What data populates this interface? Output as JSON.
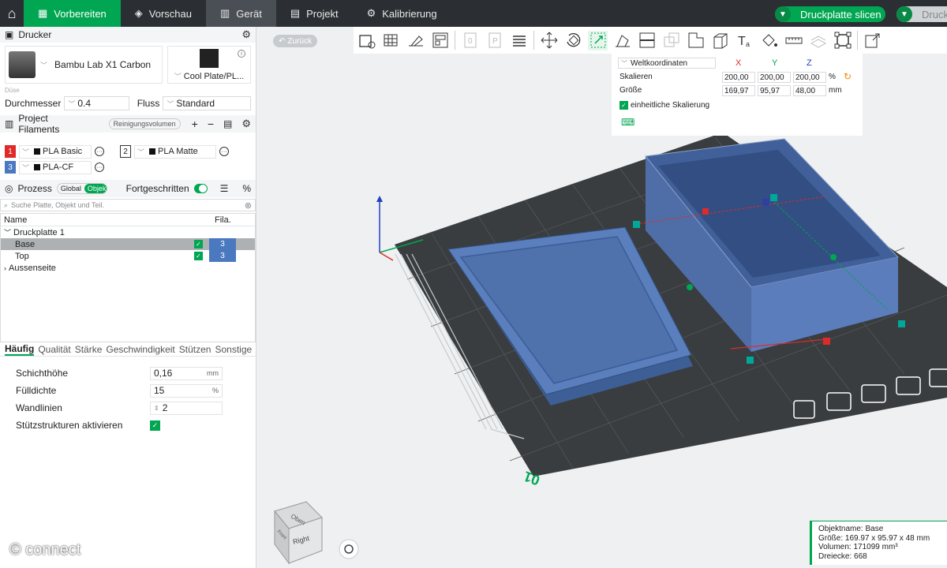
{
  "topbar": {
    "tabs": [
      {
        "label": "Vorbereiten"
      },
      {
        "label": "Vorschau"
      },
      {
        "label": "Gerät"
      },
      {
        "label": "Projekt"
      },
      {
        "label": "Kalibrierung"
      }
    ],
    "slice_label": "Druckplatte slicen",
    "print_label": "Druck"
  },
  "printer": {
    "section_title": "Drucker",
    "name": "Bambu Lab X1 Carbon",
    "plate": "Cool Plate/PL...",
    "nozzle_section": "Düse",
    "diameter_label": "Durchmesser",
    "diameter_value": "0.4",
    "flow_label": "Fluss",
    "flow_value": "Standard"
  },
  "filaments": {
    "section_title": "Project Filaments",
    "purge_label": "Reinigungsvolumen",
    "items": [
      {
        "num": "1",
        "name": "PLA Basic",
        "color": "#e02a2a"
      },
      {
        "num": "2",
        "name": "PLA Matte",
        "color": "#ffffff"
      },
      {
        "num": "3",
        "name": "PLA-CF",
        "color": "#4a79c0"
      }
    ]
  },
  "process": {
    "section_title": "Prozess",
    "mode_global": "Global",
    "mode_objects": "Objekte",
    "advanced_label": "Fortgeschritten",
    "search_placeholder": "Suche Platte, Objekt und Teil.",
    "col_name": "Name",
    "col_fila": "Fila.",
    "tree": [
      {
        "label": "Druckplatte 1"
      },
      {
        "label": "Base",
        "fila": "3"
      },
      {
        "label": "Top",
        "fila": "3"
      },
      {
        "label": "Aussenseite"
      }
    ],
    "tabs": [
      "Häufig",
      "Qualität",
      "Stärke",
      "Geschwindigkeit",
      "Stützen",
      "Sonstige"
    ],
    "params": [
      {
        "label": "Schichthöhe",
        "value": "0,16",
        "unit": "mm"
      },
      {
        "label": "Fülldichte",
        "value": "15",
        "unit": "%"
      },
      {
        "label": "Wandlinien",
        "value": "2",
        "unit": ""
      },
      {
        "label": "Stützstrukturen aktivieren",
        "checked": true
      }
    ]
  },
  "viewport": {
    "back_label": "Zurück",
    "scale_panel": {
      "coord_mode": "Weltkoordinaten",
      "axis_x": "X",
      "axis_y": "Y",
      "axis_z": "Z",
      "scale_label": "Skalieren",
      "scale_x": "200,00",
      "scale_y": "200,00",
      "scale_z": "200,00",
      "scale_unit": "%",
      "size_label": "Größe",
      "size_x": "169,97",
      "size_y": "95,97",
      "size_z": "48,00",
      "size_unit": "mm",
      "uniform_label": "einheitliche Skalierung"
    },
    "plate_number": "01",
    "cube_top": "Oben",
    "cube_right": "Right",
    "cube_front": "Front",
    "info": {
      "name": "Objektname: Base",
      "size": "Größe: 169.97 x 95.97 x 48 mm",
      "volume": "Volumen: 171099 mm³",
      "triangles": "Dreiecke: 668"
    }
  },
  "watermark": "© connect"
}
